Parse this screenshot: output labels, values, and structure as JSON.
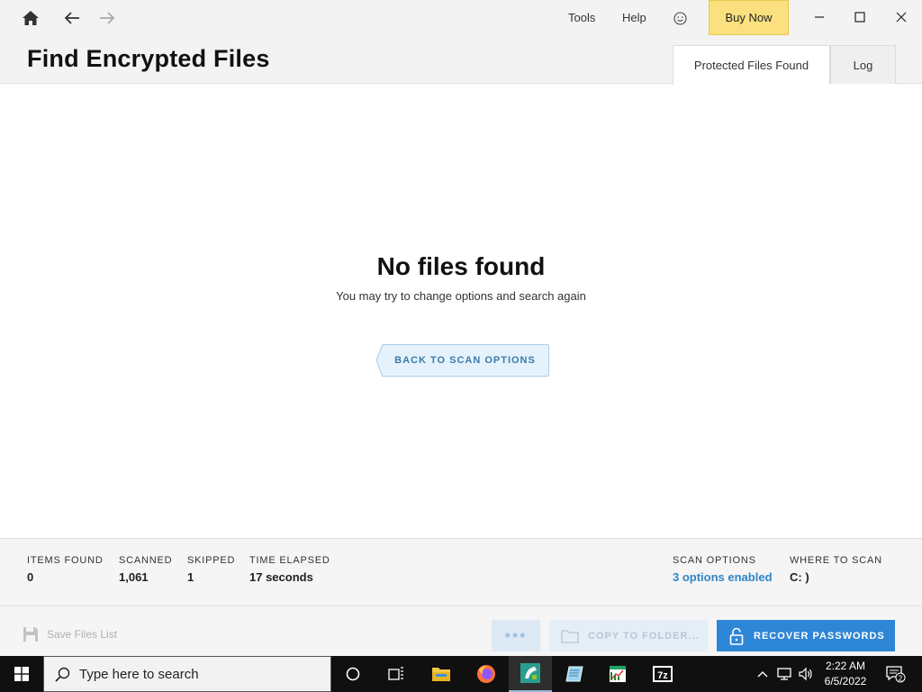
{
  "header": {
    "menu": {
      "tools": "Tools",
      "help": "Help"
    },
    "buy_now": "Buy Now",
    "page_title": "Find Encrypted Files",
    "tabs": [
      {
        "label": "Protected Files Found",
        "active": true
      },
      {
        "label": "Log",
        "active": false
      }
    ]
  },
  "main": {
    "empty_title": "No files found",
    "empty_subtitle": "You may try to change options and search again",
    "back_button": "BACK TO SCAN OPTIONS"
  },
  "stats": {
    "items_found": {
      "label": "ITEMS FOUND",
      "value": "0"
    },
    "scanned": {
      "label": "SCANNED",
      "value": "1,061"
    },
    "skipped": {
      "label": "SKIPPED",
      "value": "1"
    },
    "time_elapsed": {
      "label": "TIME ELAPSED",
      "value": "17 seconds"
    },
    "scan_options": {
      "label": "SCAN OPTIONS",
      "value": "3 options enabled"
    },
    "where_to_scan": {
      "label": "WHERE TO SCAN",
      "value": "C: )"
    }
  },
  "footer": {
    "save_files_list": "Save Files List",
    "more_button": "•••",
    "copy_to_folder": "COPY TO FOLDER...",
    "recover_passwords": "RECOVER PASSWORDS"
  },
  "taskbar": {
    "search_placeholder": "Type here to search",
    "time": "2:22 AM",
    "date": "6/5/2022",
    "notification_count": "2",
    "icons": [
      "windows-start-icon",
      "cortana-icon",
      "task-view-icon",
      "file-explorer-icon",
      "firefox-icon",
      "passware-icon",
      "notepad-icon",
      "spreadsheet-icon",
      "7zip-icon"
    ]
  },
  "colors": {
    "accent": "#2e86d6",
    "buy_now_bg": "#fbe07f",
    "link": "#2f86c8",
    "taskbar": "#101010"
  }
}
